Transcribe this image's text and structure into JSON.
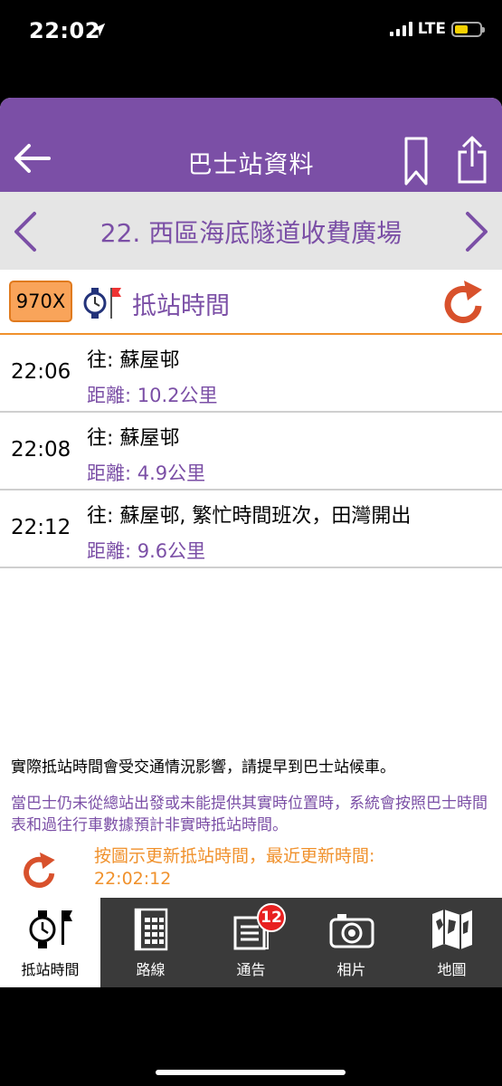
{
  "status": {
    "time": "22:02",
    "network": "LTE",
    "battery_level": 0.55
  },
  "nav": {
    "title": "巴士站資料"
  },
  "station": {
    "name": "22. 西區海底隧道收費廣場"
  },
  "route": {
    "number": "970X",
    "label": "抵站時間"
  },
  "etas": [
    {
      "time": "22:06",
      "dest": "往: 蘇屋邨",
      "dist": "距離: 10.2公里"
    },
    {
      "time": "22:08",
      "dest": "往: 蘇屋邨",
      "dist": "距離: 4.9公里"
    },
    {
      "time": "22:12",
      "dest": "往: 蘇屋邨, 繁忙時間班次，田灣開出",
      "dist": "距離: 9.6公里"
    }
  ],
  "notes": {
    "warning": "實際抵站時間會受交通情況影響，請提早到巴士站候車。",
    "schedule_note": "當巴士仍未從總站出發或未能提供其實時位置時，系統會按照巴士時間表和過往行車數據預計非實時抵站時間。",
    "update_hint": "按圖示更新抵站時間，最近更新時間:",
    "update_time": "22:02:12"
  },
  "tabs": [
    {
      "label": "抵站時間",
      "icon": "watch-flag-icon"
    },
    {
      "label": "路線",
      "icon": "timetable-icon"
    },
    {
      "label": "通告",
      "icon": "notice-icon",
      "badge": "12"
    },
    {
      "label": "相片",
      "icon": "camera-icon"
    },
    {
      "label": "地圖",
      "icon": "map-icon"
    }
  ],
  "colors": {
    "brand_purple": "#7b4fa6",
    "accent_orange": "#f0912c",
    "refresh_red": "#d8512c",
    "badge_red": "#e82020"
  }
}
